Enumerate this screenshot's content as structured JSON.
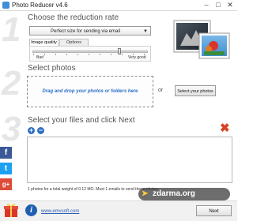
{
  "window": {
    "title": "Photo Reducer v4.6",
    "minimize": "–",
    "maximize": "□",
    "close": "✕"
  },
  "steps": {
    "one": "1",
    "two": "2",
    "three": "3"
  },
  "reduction": {
    "title": "Choose the reduction rate",
    "selected_option": "Perfect size for sending via email",
    "tabs": [
      "Image quality",
      "Options"
    ],
    "active_tab": "Image quality",
    "slider_min_label": "Bad",
    "slider_max_label": "Very good",
    "quality_fraction": 0.75
  },
  "select": {
    "title": "Select photos",
    "drop_text": "Drag and drop your photos or folders here",
    "or_label": "or",
    "select_button": "Select your photos"
  },
  "files": {
    "title": "Select your files and click Next",
    "add": "+",
    "remove": "−",
    "status": "1 photos for a total weight of 0.12 MO. Must 1 emails to send these photos"
  },
  "social": {
    "facebook": "f",
    "twitter": "t",
    "googleplus": "g+"
  },
  "footer": {
    "link": "www.emvsoft.com",
    "next_button": "Next"
  },
  "watermark": {
    "text": "zdarma.org"
  },
  "icons": {
    "app": "app-icon",
    "info": "info-icon",
    "delete": "delete-x-icon",
    "gift": "gift-icon"
  },
  "colors": {
    "accent_blue": "#2b6fc9",
    "delete_red": "#d94225",
    "facebook": "#3b5998",
    "twitter": "#1da1f2",
    "googleplus": "#dd4b39"
  }
}
